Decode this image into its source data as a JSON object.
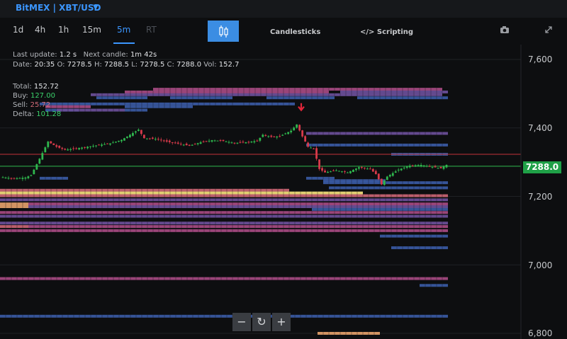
{
  "header": {
    "brand": "BitMEX | XBT/USD"
  },
  "toolbar": {
    "timeframes": [
      "1d",
      "4h",
      "1h",
      "15m",
      "5m",
      "RT"
    ],
    "active_timeframe": "5m",
    "chart_type_label": "Candlesticks",
    "scripting_label": "</> Scripting"
  },
  "info": {
    "last_update_label": "Last update:",
    "last_update": "1.2 s",
    "next_candle_label": "Next candle:",
    "next_candle": "1m 42s",
    "date_label": "Date:",
    "date": "20:35",
    "open_label": "O:",
    "open": "7278.5",
    "high_label": "H:",
    "high": "7288.5",
    "low_label": "L:",
    "low": "7278.5",
    "close_label": "C:",
    "close": "7288.0",
    "vol_label": "Vol:",
    "vol": "152.7",
    "total_label": "Total:",
    "total": "152.72",
    "buy_label": "Buy:",
    "buy": "127.00",
    "sell_label": "Sell:",
    "sell": "25.72",
    "delta_label": "Delta:",
    "delta": "101.28"
  },
  "colors": {
    "accent": "#3b96ff",
    "up": "#2fb84e",
    "down": "#d83a4a",
    "price_tag": "#1fa047"
  },
  "chart_data": {
    "type": "candlestick",
    "current_price": 7288.0,
    "current_price_label": "7288.0",
    "y_ticks": [
      7600,
      7400,
      7200,
      7000,
      6800
    ],
    "y_tick_labels": [
      "7,600",
      "7,400",
      "7,200",
      "7,000",
      "6,800"
    ],
    "ylim": [
      6790,
      7625
    ],
    "reference_line_price": 7323,
    "signal_marker_price": 7460,
    "key_points": [
      [
        0,
        7256
      ],
      [
        4,
        7252
      ],
      [
        8,
        7255
      ],
      [
        10,
        7262
      ],
      [
        13,
        7310
      ],
      [
        16,
        7360
      ],
      [
        19,
        7345
      ],
      [
        22,
        7336
      ],
      [
        26,
        7340
      ],
      [
        30,
        7345
      ],
      [
        34,
        7350
      ],
      [
        38,
        7355
      ],
      [
        42,
        7365
      ],
      [
        45,
        7380
      ],
      [
        48,
        7395
      ],
      [
        50,
        7370
      ],
      [
        54,
        7368
      ],
      [
        58,
        7360
      ],
      [
        62,
        7354
      ],
      [
        66,
        7348
      ],
      [
        70,
        7358
      ],
      [
        74,
        7364
      ],
      [
        78,
        7362
      ],
      [
        82,
        7356
      ],
      [
        86,
        7358
      ],
      [
        90,
        7362
      ],
      [
        92,
        7380
      ],
      [
        95,
        7374
      ],
      [
        98,
        7375
      ],
      [
        100,
        7384
      ],
      [
        102,
        7392
      ],
      [
        104,
        7410
      ],
      [
        106,
        7375
      ],
      [
        108,
        7345
      ],
      [
        110,
        7340
      ],
      [
        112,
        7280
      ],
      [
        114,
        7270
      ],
      [
        118,
        7276
      ],
      [
        122,
        7270
      ],
      [
        126,
        7285
      ],
      [
        130,
        7280
      ],
      [
        132,
        7265
      ],
      [
        134,
        7235
      ],
      [
        136,
        7258
      ],
      [
        140,
        7278
      ],
      [
        144,
        7290
      ],
      [
        148,
        7292
      ],
      [
        152,
        7286
      ],
      [
        155,
        7282
      ],
      [
        157,
        7292
      ]
    ],
    "candle_count": 158,
    "depth_bars": [
      [
        7513,
        0.27,
        0.78,
        3
      ],
      [
        7505,
        0.22,
        0.58,
        3
      ],
      [
        7505,
        0.6,
        0.79,
        2
      ],
      [
        7497,
        0.16,
        0.78,
        2
      ],
      [
        7488,
        0.17,
        0.26,
        1
      ],
      [
        7488,
        0.3,
        0.41,
        1
      ],
      [
        7488,
        0.47,
        0.59,
        1
      ],
      [
        7488,
        0.63,
        0.79,
        1
      ],
      [
        7470,
        0.07,
        0.42,
        1
      ],
      [
        7470,
        0.42,
        0.52,
        1
      ],
      [
        7462,
        0.08,
        0.16,
        3
      ],
      [
        7462,
        0.22,
        0.34,
        1
      ],
      [
        7452,
        0.08,
        0.14,
        1
      ],
      [
        7452,
        0.1,
        0.22,
        2
      ],
      [
        7452,
        0.22,
        0.26,
        1
      ],
      [
        7384,
        0.54,
        0.79,
        2
      ],
      [
        7350,
        0.54,
        0.79,
        1
      ],
      [
        7323,
        0.69,
        0.79,
        1
      ],
      [
        7253,
        0.07,
        0.12,
        1
      ],
      [
        7253,
        0.54,
        0.59,
        1
      ],
      [
        7246,
        0.57,
        0.68,
        1
      ],
      [
        7240,
        0.57,
        0.79,
        1
      ],
      [
        7225,
        0.58,
        0.79,
        1
      ],
      [
        7218,
        0.0,
        0.51,
        4
      ],
      [
        7210,
        0.0,
        0.64,
        6
      ],
      [
        7202,
        0.0,
        0.79,
        4
      ],
      [
        7190,
        0.0,
        0.79,
        2
      ],
      [
        7178,
        0.0,
        0.05,
        5
      ],
      [
        7178,
        0.05,
        0.79,
        3
      ],
      [
        7170,
        0.0,
        0.05,
        5
      ],
      [
        7170,
        0.05,
        0.79,
        2
      ],
      [
        7162,
        0.55,
        0.79,
        1
      ],
      [
        7153,
        0.0,
        0.79,
        3
      ],
      [
        7142,
        0.0,
        0.79,
        2
      ],
      [
        7122,
        0.0,
        0.79,
        2
      ],
      [
        7112,
        0.0,
        0.05,
        4
      ],
      [
        7112,
        0.05,
        0.79,
        3
      ],
      [
        7100,
        0.0,
        0.79,
        3
      ],
      [
        7084,
        0.67,
        0.79,
        1
      ],
      [
        7050,
        0.69,
        0.79,
        1
      ],
      [
        6960,
        0.0,
        0.79,
        3
      ],
      [
        6940,
        0.74,
        0.79,
        1
      ],
      [
        6850,
        0.0,
        0.79,
        1
      ],
      [
        6800,
        0.56,
        0.67,
        5
      ]
    ]
  }
}
